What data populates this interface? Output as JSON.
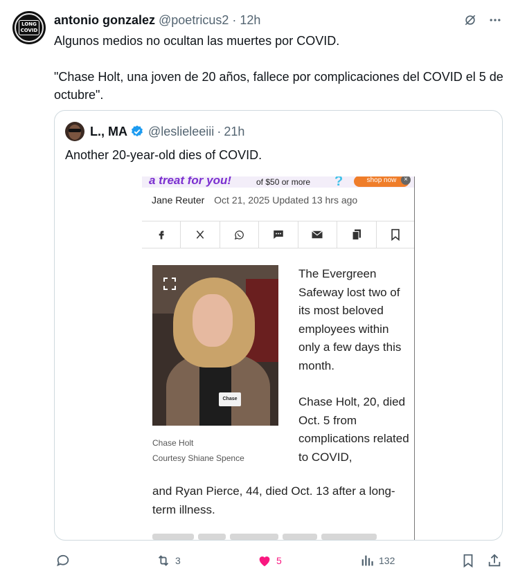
{
  "tweet": {
    "avatar_text": "LONG COVID",
    "name": "antonio gonzalez",
    "handle": "@poetricus2",
    "separator": "·",
    "time": "12h",
    "line1": "Algunos medios no ocultan las muertes por COVID.",
    "line2": "\"Chase Holt, una joven de 20 años, fallece por complicaciones del COVID el 5 de octubre\"."
  },
  "quote": {
    "name": "L., MA",
    "handle": "@leslieleeiii",
    "separator": "·",
    "time": "21h",
    "text": "Another 20-year-old dies of COVID."
  },
  "article": {
    "ad_text": "a treat for you!",
    "ad_small": "of $50 or more",
    "ad_button": "shop now",
    "author": "Jane Reuter",
    "date": "Oct 21, 2025 Updated 13 hrs ago",
    "photo_tag": "Chase",
    "caption_name": "Chase Holt",
    "caption_credit": "Courtesy Shiane Spence",
    "para1": "The Evergreen Safeway lost two of its most beloved employees within only a few days this month.",
    "para2_start": "Chase Holt, 20, died Oct. 5 from complications related to COVID,",
    "para2_end": "and Ryan Pierce, 44, died Oct. 13 after a long-term illness."
  },
  "actions": {
    "reply_count": "",
    "retweet_count": "3",
    "like_count": "5",
    "views_count": "132"
  },
  "colors": {
    "text": "#0f1419",
    "secondary": "#536471",
    "verified": "#1d9bf0",
    "like": "#f91880",
    "border": "#cfd9de"
  }
}
